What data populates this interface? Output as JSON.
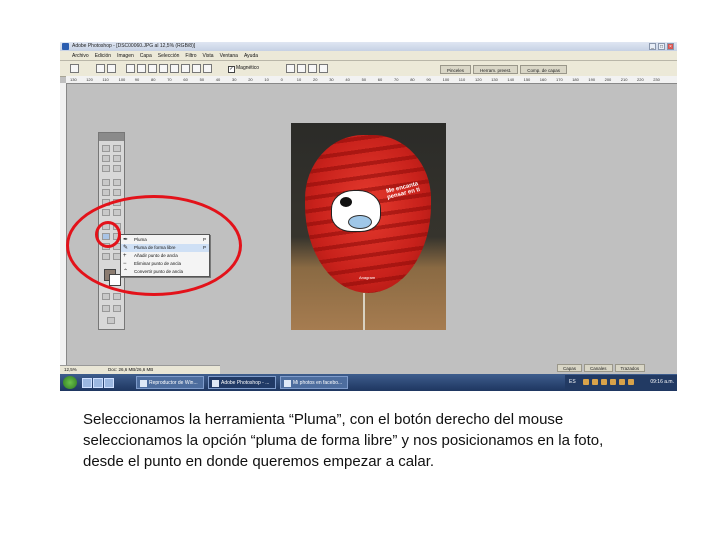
{
  "window": {
    "title": "Adobe Photoshop - [DSC00060.JPG al 12,5% (RGB/8)]",
    "buttons": [
      "_",
      "□",
      "×"
    ]
  },
  "menubar": [
    "Archivo",
    "Edición",
    "Imagen",
    "Capa",
    "Selección",
    "Filtro",
    "Vista",
    "Ventana",
    "Ayuda"
  ],
  "options_bar": {
    "magnetic_checkbox_label": "Magnético",
    "magnetic_checked": true
  },
  "palette_tabs": [
    "Pinceles",
    "Herram. preest.",
    "Comp. de capas"
  ],
  "ruler_ticks": [
    "130",
    "120",
    "110",
    "100",
    "90",
    "80",
    "70",
    "60",
    "50",
    "40",
    "30",
    "20",
    "10",
    "0",
    "10",
    "20",
    "30",
    "40",
    "50",
    "60",
    "70",
    "80",
    "90",
    "100",
    "110",
    "120",
    "130",
    "140",
    "150",
    "160",
    "170",
    "180",
    "190",
    "200",
    "210",
    "220",
    "230"
  ],
  "flyout_menu": {
    "items": [
      {
        "label": "Pluma",
        "key": "P",
        "icon": "pen-icon",
        "selected": false
      },
      {
        "label": "Pluma de forma libre",
        "key": "P",
        "icon": "freeform-pen-icon",
        "selected": true
      },
      {
        "label": "Añadir punto de ancla",
        "key": "",
        "icon": "add-anchor-icon",
        "selected": false
      },
      {
        "label": "Eliminar punto de ancla",
        "key": "",
        "icon": "delete-anchor-icon",
        "selected": false
      },
      {
        "label": "Convertir punto de ancla",
        "key": "",
        "icon": "convert-anchor-icon",
        "selected": false
      }
    ]
  },
  "photo": {
    "balloon_text": "Me encanta pensar en ti",
    "brand": "Anagram"
  },
  "layer_panel_tabs": [
    "Capas",
    "Canales",
    "Trazados"
  ],
  "statusbar": {
    "zoom": "12,5%",
    "doc": "Doc: 26,6 MB/26,6 MB"
  },
  "taskbar": {
    "tasks": [
      {
        "label": "Reproductor de Win...",
        "active": false
      },
      {
        "label": "Adobe Photoshop - ...",
        "active": true
      },
      {
        "label": "Mi photos en facebo...",
        "active": false
      }
    ],
    "lang": "ES",
    "clock": "09:16 a.m."
  },
  "caption": "Seleccionamos la herramienta “Pluma”, con el botón derecho del mouse seleccionamos la opción “pluma de forma libre” y nos posicionamos en la foto, desde el punto en donde queremos empezar a calar.",
  "colors": {
    "annotation_red": "#e3121a",
    "foreground_color": "#8c7c70",
    "background_color": "#ffffff"
  }
}
